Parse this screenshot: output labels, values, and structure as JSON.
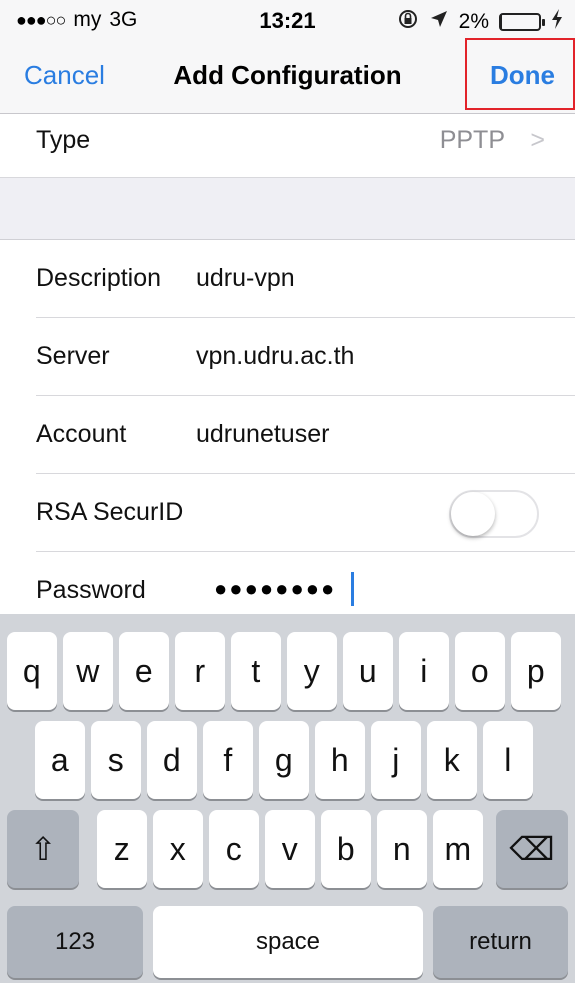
{
  "status_bar": {
    "signal": "●●●○○",
    "carrier": "my",
    "network": "3G",
    "time": "13:21",
    "lock_icon": "orientation-lock-icon",
    "location_icon": "location-arrow-icon",
    "battery_percent": "2%",
    "battery_level": 0.02,
    "charging_icon": "bolt-icon"
  },
  "nav": {
    "cancel_label": "Cancel",
    "title": "Add Configuration",
    "done_label": "Done",
    "highlight_color": "#e2232a",
    "accent_color": "#2a7de1"
  },
  "type_row": {
    "label": "Type",
    "value": "PPTP",
    "chevron": ">"
  },
  "fields": {
    "description": {
      "label": "Description",
      "value": "udru-vpn"
    },
    "server": {
      "label": "Server",
      "value": "vpn.udru.ac.th"
    },
    "account": {
      "label": "Account",
      "value": "udrunetuser"
    },
    "rsa": {
      "label": "RSA SecurID",
      "enabled": false
    },
    "password": {
      "label": "Password",
      "value": "●●●●●●●●"
    }
  },
  "keyboard": {
    "row1": [
      "q",
      "w",
      "e",
      "r",
      "t",
      "y",
      "u",
      "i",
      "o",
      "p"
    ],
    "row2": [
      "a",
      "s",
      "d",
      "f",
      "g",
      "h",
      "j",
      "k",
      "l"
    ],
    "row3": [
      "z",
      "x",
      "c",
      "v",
      "b",
      "n",
      "m"
    ],
    "shift_glyph": "⇧",
    "delete_glyph": "⌫",
    "numbers_label": "123",
    "space_label": "space",
    "return_label": "return"
  }
}
